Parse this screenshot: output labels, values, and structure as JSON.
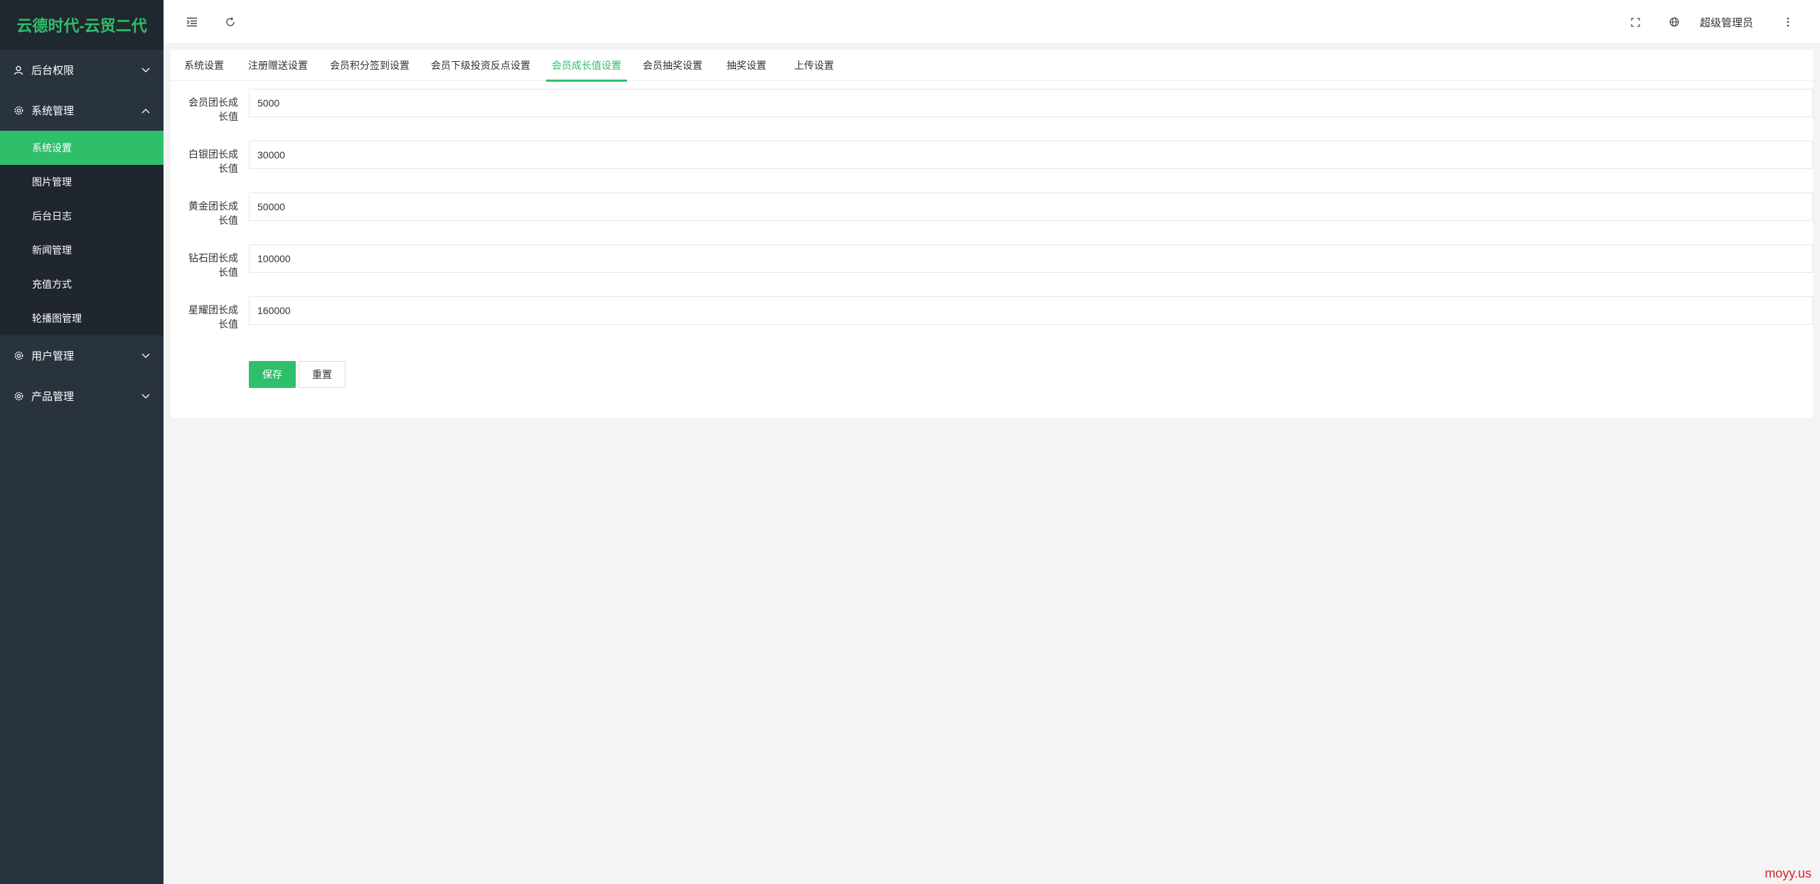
{
  "app": {
    "title": "云德时代-云贸二代"
  },
  "sidebar": {
    "groups": [
      {
        "label": "后台权限",
        "icon": "user-icon",
        "expanded": false
      },
      {
        "label": "系统管理",
        "icon": "gear-icon",
        "expanded": true,
        "items": [
          {
            "label": "系统设置",
            "active": true
          },
          {
            "label": "图片管理"
          },
          {
            "label": "后台日志"
          },
          {
            "label": "新闻管理"
          },
          {
            "label": "充值方式"
          },
          {
            "label": "轮播图管理"
          }
        ]
      },
      {
        "label": "用户管理",
        "icon": "gear-icon",
        "expanded": false
      },
      {
        "label": "产品管理",
        "icon": "gear-icon",
        "expanded": false
      }
    ]
  },
  "header": {
    "user": "超级管理员"
  },
  "tabs": [
    {
      "label": "系统设置"
    },
    {
      "label": "注册赠送设置"
    },
    {
      "label": "会员积分签到设置"
    },
    {
      "label": "会员下级投资反点设置"
    },
    {
      "label": "会员成长值设置",
      "active": true
    },
    {
      "label": "会员抽奖设置"
    },
    {
      "label": "抽奖设置"
    },
    {
      "label": "上传设置"
    }
  ],
  "form": {
    "fields": [
      {
        "label": "会员团长成长值",
        "value": "5000"
      },
      {
        "label": "白银团长成长值",
        "value": "30000"
      },
      {
        "label": "黄金团长成长值",
        "value": "50000"
      },
      {
        "label": "钻石团长成长值",
        "value": "100000"
      },
      {
        "label": "星耀团长成长值",
        "value": "160000"
      }
    ],
    "save_label": "保存",
    "reset_label": "重置"
  },
  "watermark": "moyy.us",
  "colors": {
    "accent": "#2fbf6a",
    "sidebar_bg": "#28333e",
    "sidebar_logo_bg": "#20282f",
    "watermark": "#d9232d"
  }
}
